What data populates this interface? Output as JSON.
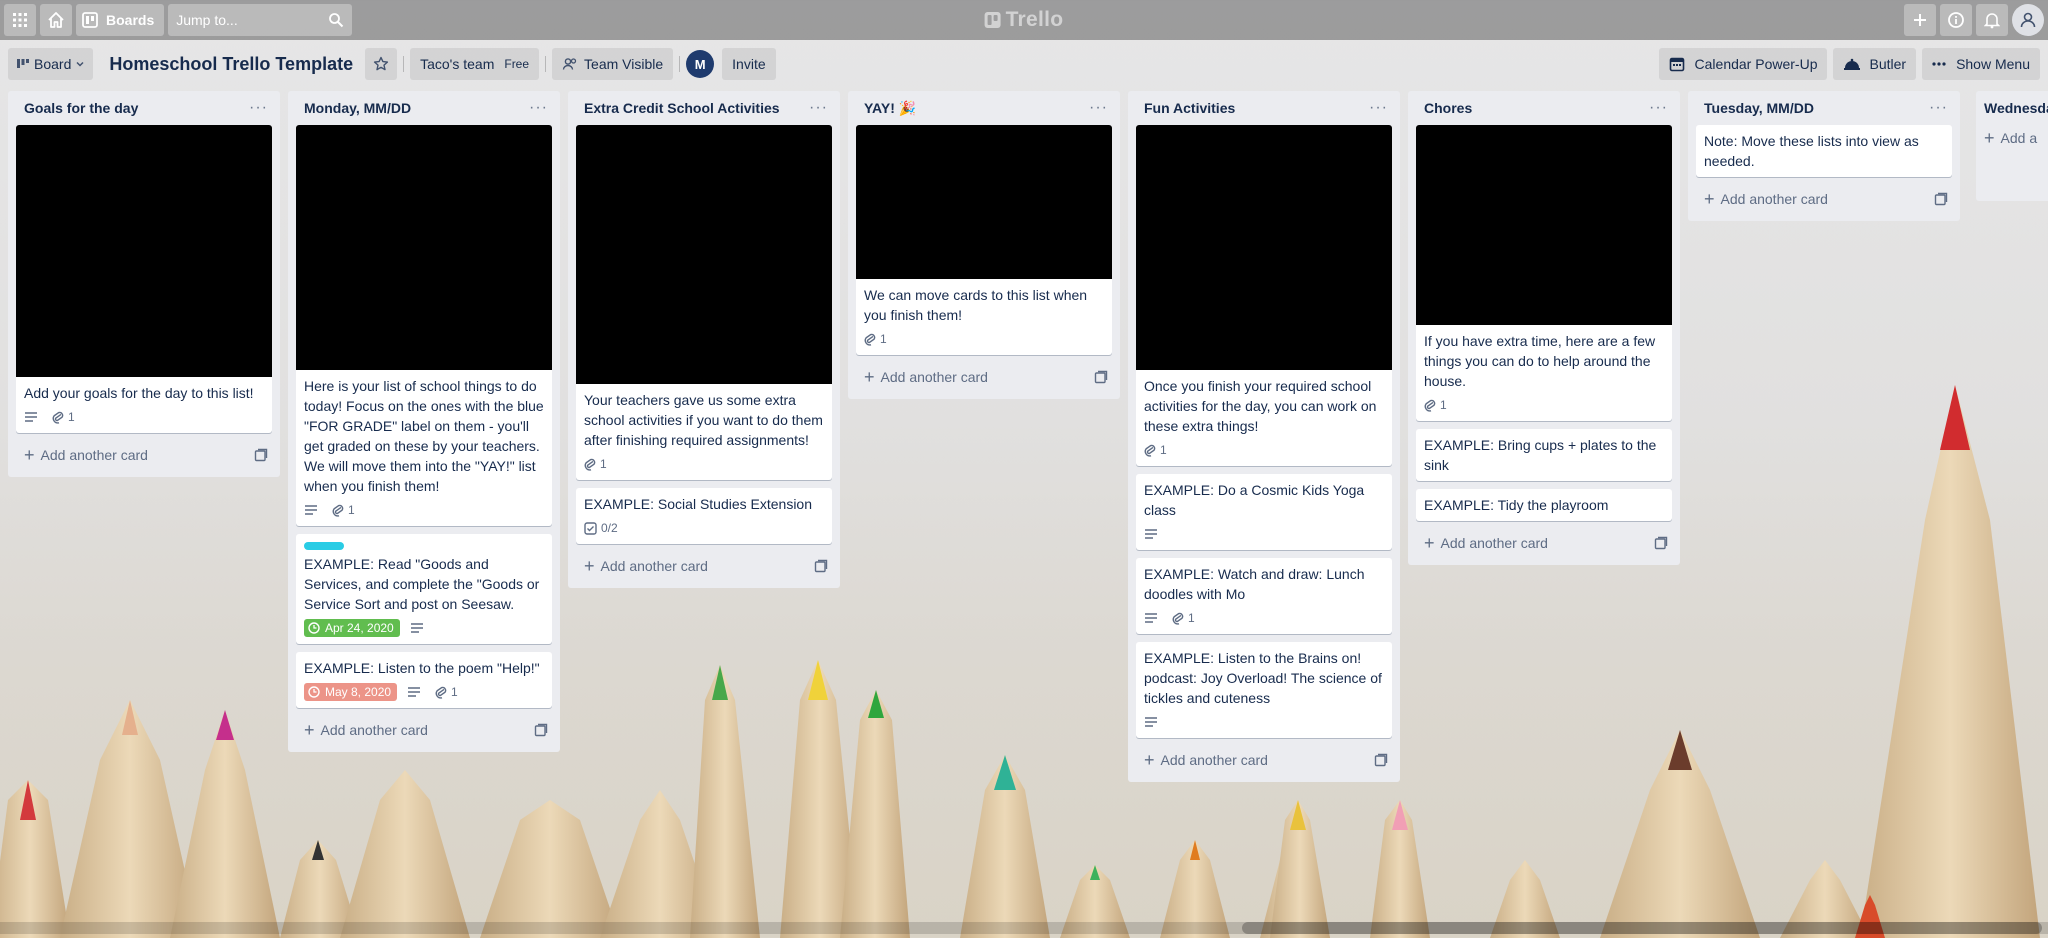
{
  "header": {
    "boards_label": "Boards",
    "search_placeholder": "Jump to...",
    "logo_text": "Trello"
  },
  "board": {
    "view_label": "Board",
    "title": "Homeschool Trello Template",
    "team_name": "Taco's team",
    "team_plan": "Free",
    "visibility_label": "Team Visible",
    "member_initial": "M",
    "invite_label": "Invite",
    "powerup_label": "Calendar Power-Up",
    "butler_label": "Butler",
    "menu_label": "Show Menu"
  },
  "add_card_label": "Add another card",
  "lists": [
    {
      "title": "Goals for the day",
      "cards": [
        {
          "text": "Add your goals for the day to this list!",
          "attachments": "1"
        }
      ]
    },
    {
      "title": "Monday, MM/DD",
      "cards": [
        {
          "text": "Here is your list of school things to do today! Focus on the ones with the blue \"FOR GRADE\" label on them - you'll get graded on these by your teachers. We will move them into the \"YAY!\" list when you finish them!",
          "attachments": "1"
        },
        {
          "text": "EXAMPLE: Read \"Goods and Services, and complete the \"Goods or Service Sort and post on Seesaw.",
          "due": "Apr 24, 2020"
        },
        {
          "text": "EXAMPLE: Listen to the poem \"Help!\"",
          "due": "May 8, 2020",
          "attachments": "1"
        }
      ]
    },
    {
      "title": "Extra Credit School Activities",
      "cards": [
        {
          "text": "Your teachers gave us some extra school activities if you want to do them after finishing required assignments!",
          "attachments": "1"
        },
        {
          "text": "EXAMPLE: Social Studies Extension",
          "checklist": "0/2"
        }
      ]
    },
    {
      "title": "YAY! 🎉",
      "cards": [
        {
          "text": "We can move cards to this list when you finish them!",
          "attachments": "1"
        }
      ]
    },
    {
      "title": "Fun Activities",
      "cards": [
        {
          "text": "Once you finish your required school activities for the day, you can work on these extra things!",
          "attachments": "1"
        },
        {
          "text": "EXAMPLE: Do a Cosmic Kids Yoga class"
        },
        {
          "text": "EXAMPLE: Watch and draw: Lunch doodles with Mo",
          "attachments": "1"
        },
        {
          "text": "EXAMPLE: Listen to the Brains on! podcast: Joy Overload! The science of tickles and cuteness"
        }
      ]
    },
    {
      "title": "Chores",
      "cards": [
        {
          "text": "If you have extra time, here are a few things you can do to help around the house.",
          "attachments": "1"
        },
        {
          "text": "EXAMPLE: Bring cups + plates to the sink"
        },
        {
          "text": "EXAMPLE: Tidy the playroom"
        }
      ]
    },
    {
      "title": "Tuesday, MM/DD",
      "cards": [
        {
          "text": "Note: Move these lists into view as needed."
        }
      ]
    }
  ],
  "partial_list": {
    "title": "Wednesda",
    "add_label": "Add a"
  },
  "colors": {
    "label_blue": "#29cce5",
    "due_green": "#61bd4f",
    "due_red": "#ec9488",
    "list_bg": "#ebecf0"
  }
}
